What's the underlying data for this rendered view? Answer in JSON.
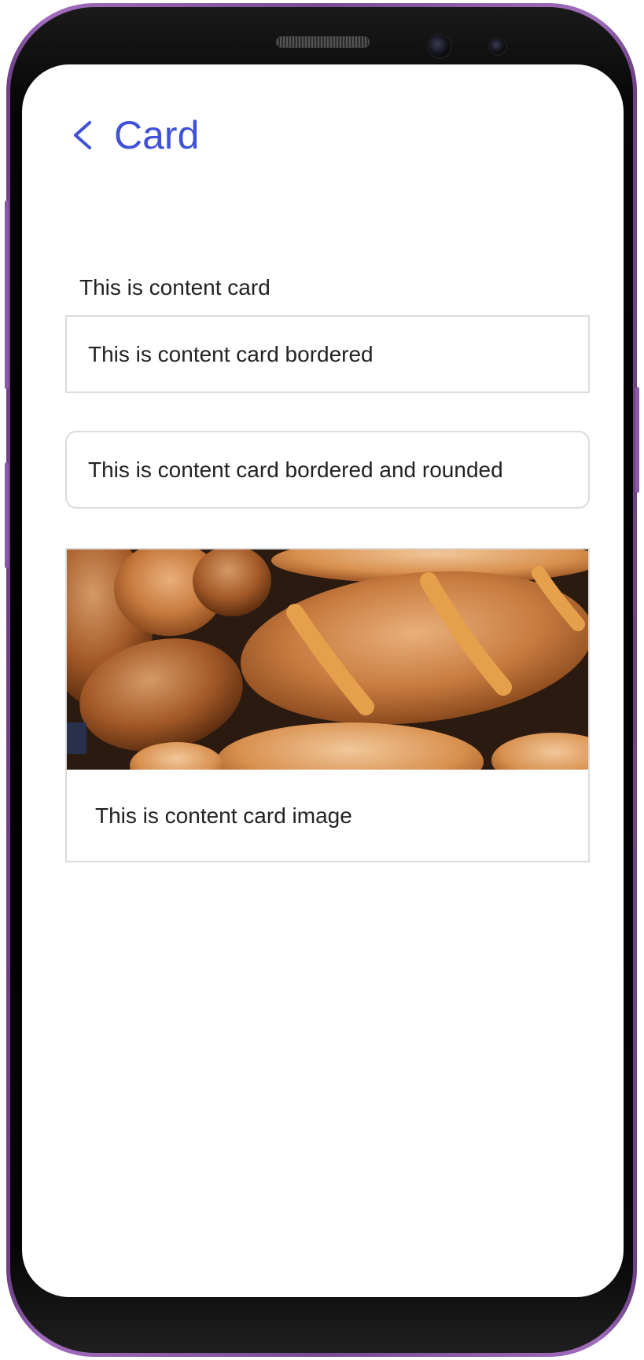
{
  "header": {
    "title": "Card",
    "back_icon": "chevron-left-icon"
  },
  "cards": {
    "plain": "This is content card",
    "bordered": "This is content card bordered",
    "rounded": "This is content card bordered and rounded",
    "image_caption": "This is content card image"
  },
  "colors": {
    "accent": "#3f51d8",
    "border": "#dcdcdc",
    "device_frame": "#7a4a94"
  }
}
